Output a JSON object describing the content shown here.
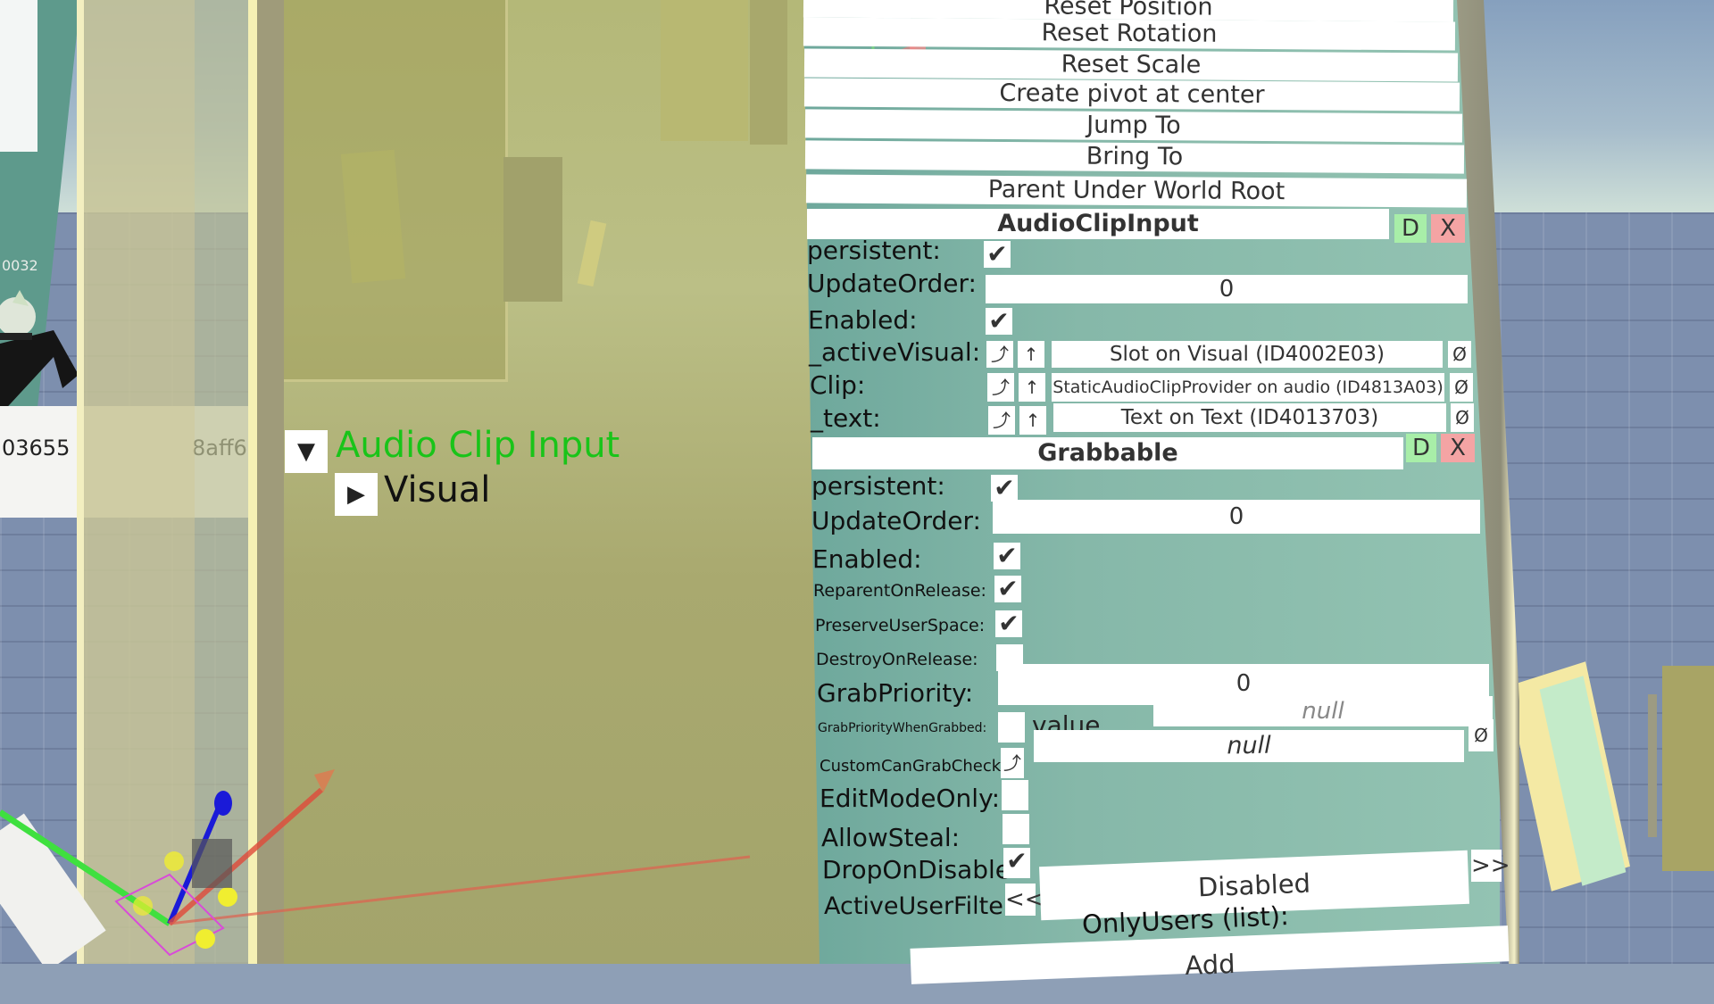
{
  "scene": {
    "background_labels": {
      "left_id_top": "0032",
      "left_id_bottom": "03655",
      "left_id_mid": "8aff6"
    }
  },
  "hierarchy": {
    "root": {
      "label": "Audio Clip Input",
      "expanded": true,
      "toggle_icon": "▼",
      "color": "#19c419"
    },
    "children": [
      {
        "label": "Visual",
        "expanded": false,
        "toggle_icon": "▶"
      }
    ]
  },
  "inspector": {
    "slot_actions": [
      "Reset Position",
      "Reset Rotation",
      "Reset Scale",
      "Create pivot at center",
      "Jump To",
      "Bring To",
      "Parent Under World Root"
    ],
    "components": [
      {
        "name": "AudioClipInput",
        "duplicate_label": "D",
        "remove_label": "X",
        "fields": {
          "persistent": {
            "label": "persistent:",
            "checked": true
          },
          "update_order": {
            "label": "UpdateOrder:",
            "value": "0"
          },
          "enabled": {
            "label": "Enabled:",
            "checked": true
          },
          "active_visual": {
            "label": "_activeVisual:",
            "value": "Slot on Visual (ID4002E03)"
          },
          "clip": {
            "label": "Clip:",
            "value": "StaticAudioClipProvider on audio (ID4813A03)"
          },
          "text": {
            "label": "_text:",
            "value": "Text on Text (ID4013703)"
          }
        }
      },
      {
        "name": "Grabbable",
        "duplicate_label": "D",
        "remove_label": "X",
        "fields": {
          "persistent": {
            "label": "persistent:",
            "checked": true
          },
          "update_order": {
            "label": "UpdateOrder:",
            "value": "0"
          },
          "enabled": {
            "label": "Enabled:",
            "checked": true
          },
          "reparent_on_release": {
            "label": "ReparentOnRelease:",
            "checked": true
          },
          "preserve_user_space": {
            "label": "PreserveUserSpace:",
            "checked": true
          },
          "destroy_on_release": {
            "label": "DestroyOnRelease:",
            "checked": false
          },
          "grab_priority": {
            "label": "GrabPriority:",
            "value": "0"
          },
          "grab_priority_when_grabbed": {
            "label": "GrabPriorityWhenGrabbed:",
            "checked": false,
            "sub_label": "value",
            "value": "null"
          },
          "custom_can_grab_check": {
            "label": "CustomCanGrabCheck:",
            "value": "null"
          },
          "edit_mode_only": {
            "label": "EditModeOnly:",
            "checked": false
          },
          "allow_steal": {
            "label": "AllowSteal:",
            "checked": false
          },
          "drop_on_disable": {
            "label": "DropOnDisable:",
            "checked": true
          },
          "active_user_filter": {
            "label": "ActiveUserFilter:",
            "value": "Disabled",
            "prev_label": "<<",
            "next_label": ">>"
          },
          "only_users": {
            "label": "OnlyUsers (list):",
            "add_label": "Add"
          }
        }
      }
    ],
    "icons": {
      "checkmark": "✔",
      "null_ref": "Ø",
      "jump_ref": "⤴",
      "up_ref": "↑"
    },
    "colors": {
      "panel_bg": "#86b8a9",
      "duplicate_bg": "#a8eea8",
      "remove_bg": "#f4a4a4",
      "hierarchy_root": "#19c419"
    }
  }
}
